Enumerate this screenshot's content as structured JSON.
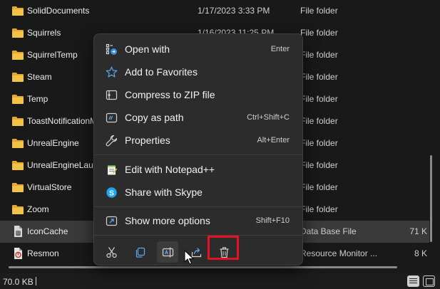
{
  "files": [
    {
      "name": "SolidDocuments",
      "date": "1/17/2023 3:33 PM",
      "type": "File folder",
      "size": "",
      "icon": "folder-icon"
    },
    {
      "name": "Squirrels",
      "date": "1/16/2023 11:25 PM",
      "type": "File folder",
      "size": "",
      "icon": "folder-icon"
    },
    {
      "name": "SquirrelTemp",
      "date": "",
      "type": "File folder",
      "size": "",
      "icon": "folder-icon"
    },
    {
      "name": "Steam",
      "date": "",
      "type": "File folder",
      "size": "",
      "icon": "folder-icon"
    },
    {
      "name": "Temp",
      "date": "",
      "type": "File folder",
      "size": "",
      "icon": "folder-icon"
    },
    {
      "name": "ToastNotificationM",
      "date": "",
      "type": "File folder",
      "size": "",
      "icon": "folder-icon"
    },
    {
      "name": "UnrealEngine",
      "date": "",
      "type": "File folder",
      "size": "",
      "icon": "folder-icon"
    },
    {
      "name": "UnrealEngineLaun",
      "date": "",
      "type": "File folder",
      "size": "",
      "icon": "folder-icon"
    },
    {
      "name": "VirtualStore",
      "date": "",
      "type": "File folder",
      "size": "",
      "icon": "folder-icon"
    },
    {
      "name": "Zoom",
      "date": "",
      "type": "File folder",
      "size": "",
      "icon": "folder-icon"
    },
    {
      "name": "IconCache",
      "date": "",
      "type": "Data Base File",
      "size": "71 K",
      "icon": "database-file-icon"
    },
    {
      "name": "Resmon",
      "date": "",
      "type": "Resource Monitor ...",
      "size": "8 K",
      "icon": "resource-monitor-file-icon"
    }
  ],
  "status_bar": {
    "selection_size": "70.0 KB"
  },
  "context_menu": {
    "items": [
      {
        "label": "Open with",
        "shortcut": "Enter",
        "icon": "open-with-icon"
      },
      {
        "label": "Add to Favorites",
        "shortcut": "",
        "icon": "star-icon"
      },
      {
        "label": "Compress to ZIP file",
        "shortcut": "",
        "icon": "zip-icon"
      },
      {
        "label": "Copy as path",
        "shortcut": "Ctrl+Shift+C",
        "icon": "copy-path-icon"
      },
      {
        "label": "Properties",
        "shortcut": "Alt+Enter",
        "icon": "wrench-icon"
      },
      {
        "label": "Edit with Notepad++",
        "shortcut": "",
        "icon": "notepad-plus-plus-icon"
      },
      {
        "label": "Share with Skype",
        "shortcut": "",
        "icon": "skype-icon"
      },
      {
        "label": "Show more options",
        "shortcut": "Shift+F10",
        "icon": "show-more-options-icon"
      }
    ],
    "actions": [
      "cut-icon",
      "copy-icon",
      "rename-icon",
      "share-icon",
      "delete-icon"
    ],
    "highlighted_action": "delete-icon"
  },
  "colors": {
    "background": "#191919",
    "menu_background": "#2c2c2c",
    "folder": "#f3c347",
    "highlight": "#e81123",
    "skype": "#1aa7ec"
  }
}
